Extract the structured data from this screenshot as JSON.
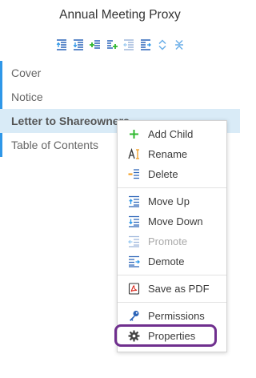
{
  "panel": {
    "title": "Annual Meeting Proxy"
  },
  "toolbar": {
    "icons": [
      "move-up-icon",
      "move-down-icon",
      "add-child-icon",
      "add-sibling-icon",
      "promote-icon",
      "demote-icon",
      "expand-all-icon",
      "collapse-all-icon"
    ]
  },
  "tree": {
    "items": [
      {
        "label": "Cover"
      },
      {
        "label": "Notice"
      },
      {
        "label": "Letter to Shareowners"
      },
      {
        "label": "Table of Contents"
      }
    ]
  },
  "context_menu": {
    "items": [
      {
        "label": "Add Child",
        "icon": "plus-icon"
      },
      {
        "label": "Rename",
        "icon": "rename-icon"
      },
      {
        "label": "Delete",
        "icon": "delete-icon"
      },
      {
        "label": "Move Up",
        "icon": "move-up-icon"
      },
      {
        "label": "Move Down",
        "icon": "move-down-icon"
      },
      {
        "label": "Promote",
        "icon": "promote-icon"
      },
      {
        "label": "Demote",
        "icon": "demote-icon"
      },
      {
        "label": "Save as PDF",
        "icon": "pdf-icon"
      },
      {
        "label": "Permissions",
        "icon": "key-icon"
      },
      {
        "label": "Properties",
        "icon": "gear-icon"
      }
    ]
  },
  "colors": {
    "accent": "#2f97e8",
    "selection": "#d9ebf7",
    "highlight_ring": "#6f2f8e",
    "add_green": "#2eb82e",
    "delete_orange": "#f29c1f"
  }
}
